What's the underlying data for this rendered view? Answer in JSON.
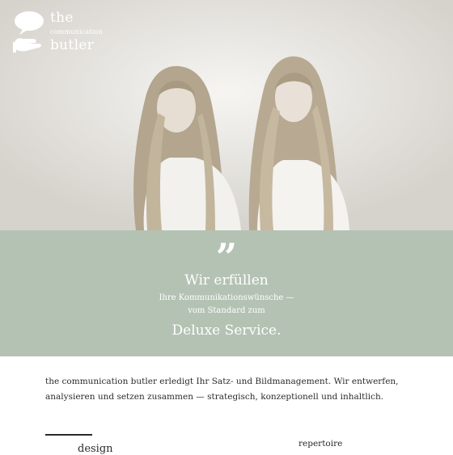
{
  "logo": {
    "line1": "the",
    "line2": "communication",
    "line3": "butler",
    "icon": "speech-bubble-hand-icon"
  },
  "quote": {
    "mark": "”",
    "line1": "Wir erfüllen",
    "line2": "Ihre Kommunikationswünsche —",
    "line3": "vom Standard zum",
    "line4": "Deluxe Service."
  },
  "intro": {
    "text": "the communication butler erledigt Ihr Satz- und Bildmanagement. Wir entwerfen, analysieren und setzen zusammen — strategisch, konzeptionell und inhaltlich."
  },
  "sections": {
    "left_heading": "design",
    "right_heading": "repertoire"
  },
  "colors": {
    "band": "#b4c2b3",
    "text": "#2a2a2a",
    "logo": "#ffffff"
  }
}
